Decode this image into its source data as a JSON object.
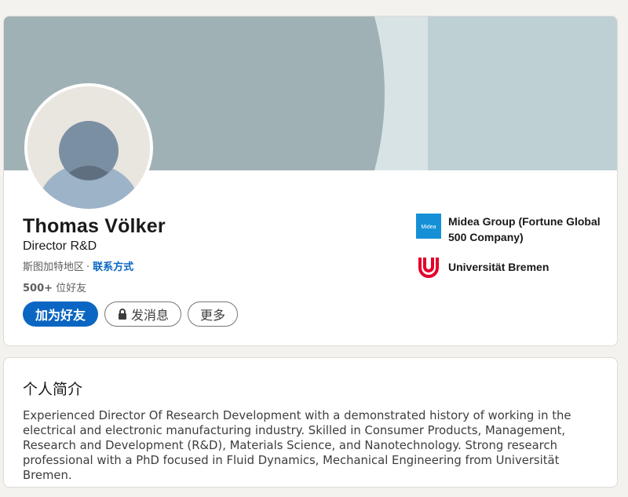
{
  "profile": {
    "name": "Thomas Völker",
    "headline": "Director R&D",
    "location": "斯图加特地区",
    "separator": "·",
    "contact_info": "联系方式",
    "connections_count": "500+",
    "connections_label": "位好友"
  },
  "actions": {
    "connect": "加为好友",
    "message": "发消息",
    "more": "更多"
  },
  "experience": [
    {
      "name": "Midea Group (Fortune Global 500 Company)",
      "logo_icon": "midea-logo",
      "logo_text": "Midea"
    },
    {
      "name": "Universität Bremen",
      "logo_icon": "uni-bremen-logo"
    }
  ],
  "about": {
    "title": "个人简介",
    "text": "Experienced Director Of Research Development with a demonstrated history of working in the electrical and electronic manufacturing industry. Skilled in Consumer Products, Management, Research and Development (R&D), Materials Science, and Nanotechnology. Strong research professional with a PhD focused in Fluid Dynamics, Mechanical Engineering from Universität Bremen."
  },
  "colors": {
    "accent": "#0a66c2",
    "banner_main": "#a0b1b5",
    "banner_light": "#d8e3e5",
    "banner_right": "#bed0d4",
    "midea_blue": "#1590d6",
    "bremen_red": "#e3002b"
  }
}
